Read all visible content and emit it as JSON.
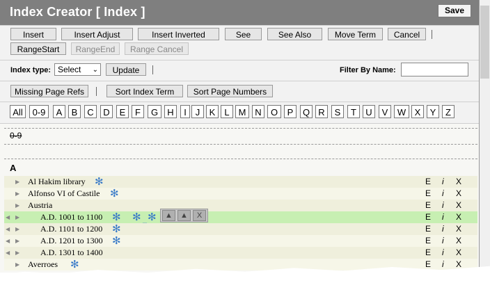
{
  "window": {
    "title": "Index Creator [ Index ]",
    "save_label": "Save"
  },
  "toolbar": {
    "row1": [
      "Insert",
      "Insert Adjust",
      "Insert Inverted",
      "See",
      "See Also",
      "Move Term",
      "Cancel"
    ],
    "row2": [
      "RangeStart",
      "RangeEnd",
      "Range Cancel"
    ]
  },
  "filter": {
    "index_type_label": "Index type:",
    "index_type_value": "Select",
    "update_label": "Update",
    "filter_label": "Filter By Name:",
    "filter_value": ""
  },
  "sort": {
    "missing": "Missing Page Refs",
    "sort_index": "Sort Index Term",
    "sort_page": "Sort Page Numbers"
  },
  "letters": [
    "All",
    "0-9",
    "A",
    "B",
    "C",
    "D",
    "E",
    "F",
    "G",
    "H",
    "I",
    "J",
    "K",
    "L",
    "M",
    "N",
    "O",
    "P",
    "Q",
    "R",
    "S",
    "T",
    "U",
    "V",
    "W",
    "X",
    "Y",
    "Z"
  ],
  "sections": {
    "numeric": "0-9",
    "a": "A"
  },
  "entries": [
    {
      "text": "Al Hakim library",
      "level": 0,
      "asterisks": 1
    },
    {
      "text": "Alfonso VI of Castile",
      "level": 0,
      "asterisks": 1
    },
    {
      "text": "Austria",
      "level": 0,
      "asterisks": 0
    },
    {
      "text": "A.D. 1001 to 1100",
      "level": 1,
      "asterisks": 3,
      "highlighted": true
    },
    {
      "text": "A.D. 1101 to 1200",
      "level": 1,
      "asterisks": 1
    },
    {
      "text": "A.D. 1201 to 1300",
      "level": 1,
      "asterisks": 1
    },
    {
      "text": "A.D. 1301 to 1400",
      "level": 1,
      "asterisks": 0
    },
    {
      "text": "Averroes",
      "level": 0,
      "asterisks": 1
    }
  ],
  "row_actions": {
    "edit": "E",
    "info": "i",
    "delete": "X"
  },
  "asterisk_symbol": "✻",
  "mover": {
    "up1": "▲",
    "up2": "▲",
    "close": "X"
  },
  "colors": {
    "titlebar": "#7f7f7f",
    "highlight": "#c7efb2",
    "asterisk": "#3a7bc8"
  }
}
